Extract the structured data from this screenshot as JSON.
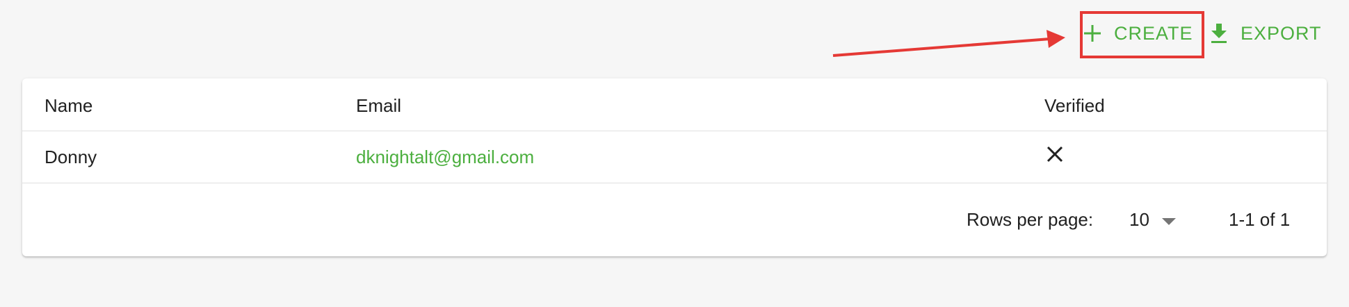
{
  "toolbar": {
    "create_label": "CREATE",
    "export_label": "EXPORT",
    "accent_color": "#4caf3f"
  },
  "annotation": {
    "highlight_color": "#e53935"
  },
  "table": {
    "columns": [
      "Name",
      "Email",
      "Verified"
    ],
    "rows": [
      {
        "name": "Donny",
        "email": "dknightalt@gmail.com",
        "verified_icon": "close-icon"
      }
    ]
  },
  "pagination": {
    "rows_per_page_label": "Rows per page:",
    "rows_per_page_value": "10",
    "range_text": "1-1 of 1"
  }
}
